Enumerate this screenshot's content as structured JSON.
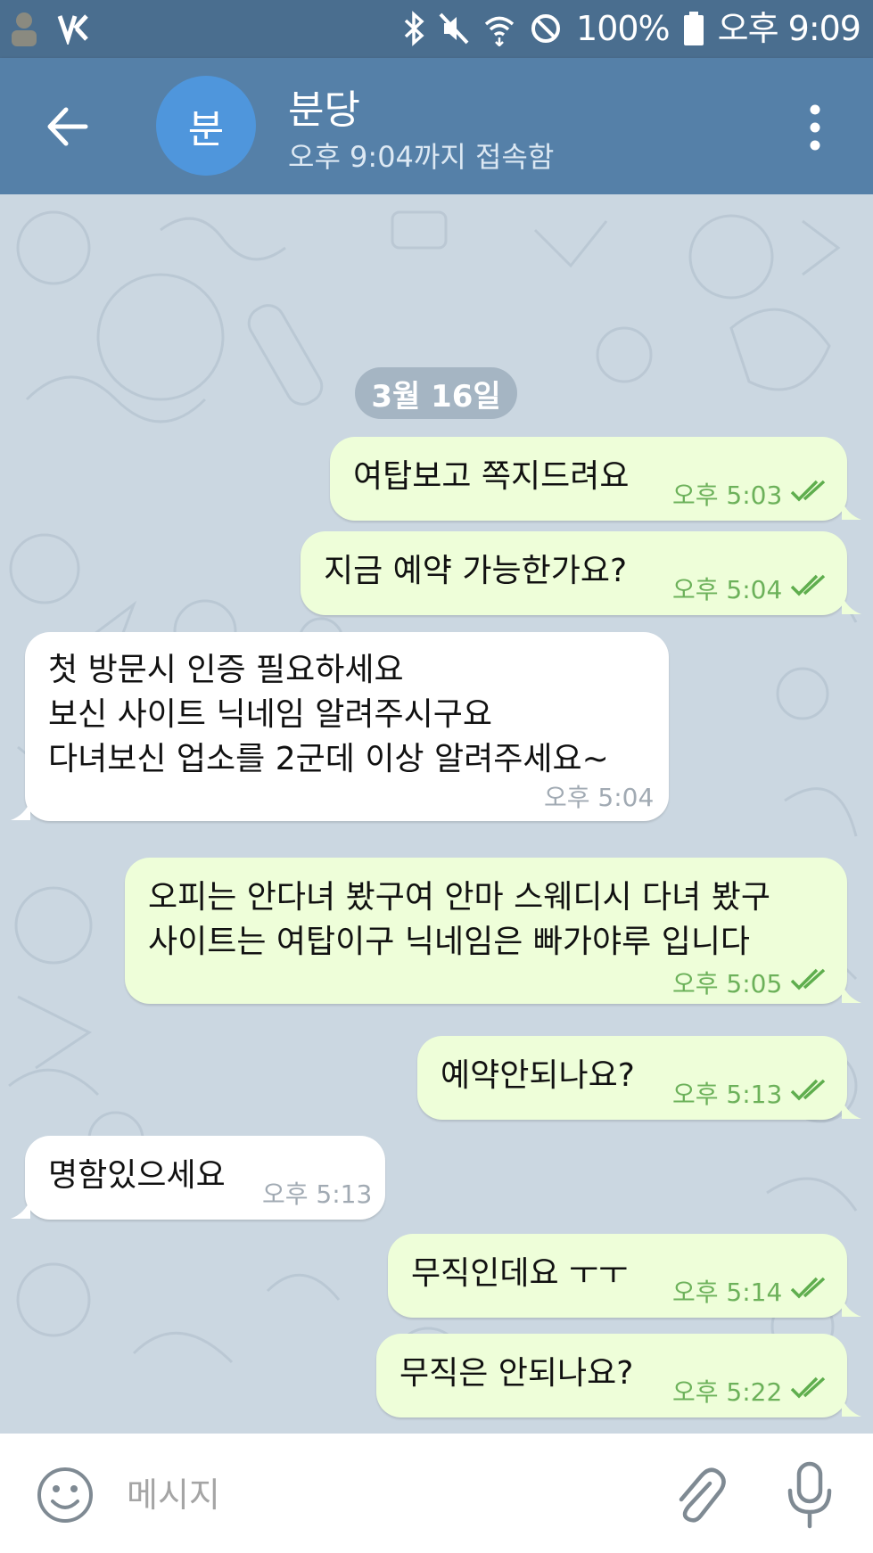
{
  "status_bar": {
    "battery": "100%",
    "time": "오후 9:09"
  },
  "header": {
    "avatar_letter": "분",
    "contact_name": "분당",
    "last_seen": "오후 9:04까지 접속함"
  },
  "chat": {
    "date_label": "3월 16일",
    "messages": [
      {
        "direction": "out",
        "text": "여탑보고 쪽지드려요",
        "time": "오후 5:03",
        "read": true
      },
      {
        "direction": "out",
        "text": "지금 예약 가능한가요?",
        "time": "오후 5:04",
        "read": true
      },
      {
        "direction": "in",
        "text": "첫 방문시 인증 필요하세요\n보신 사이트 닉네임 알려주시구요\n다녀보신 업소를 2군데 이상 알려주세요~",
        "time": "오후 5:04"
      },
      {
        "direction": "out",
        "text": "오피는 안다녀 봤구여 안마 스웨디시 다녀 봤구\n사이트는 여탑이구 닉네임은 빠가야루 입니다",
        "time": "오후 5:05",
        "read": true
      },
      {
        "direction": "out",
        "text": "예약안되나요?",
        "time": "오후 5:13",
        "read": true
      },
      {
        "direction": "in",
        "text": "명함있으세요",
        "time": "오후 5:13"
      },
      {
        "direction": "out",
        "text": "무직인데요 ㅜㅜ",
        "time": "오후 5:14",
        "read": true
      },
      {
        "direction": "out",
        "text": "무직은 안되나요?",
        "time": "오후 5:22",
        "read": true
      }
    ]
  },
  "input_bar": {
    "placeholder": "메시지"
  },
  "colors": {
    "status_bar": "#4a6e8f",
    "header": "#5580a8",
    "outgoing_bubble": "#eefed9",
    "incoming_bubble": "#ffffff",
    "outgoing_time": "#6cb15a",
    "avatar": "#4f96dc"
  },
  "icons": [
    "back-arrow-icon",
    "more-vert-icon",
    "emoji-icon",
    "attach-icon",
    "microphone-icon",
    "bluetooth-icon",
    "mute-icon",
    "wifi-icon",
    "blocked-icon",
    "battery-icon",
    "double-check-icon"
  ]
}
